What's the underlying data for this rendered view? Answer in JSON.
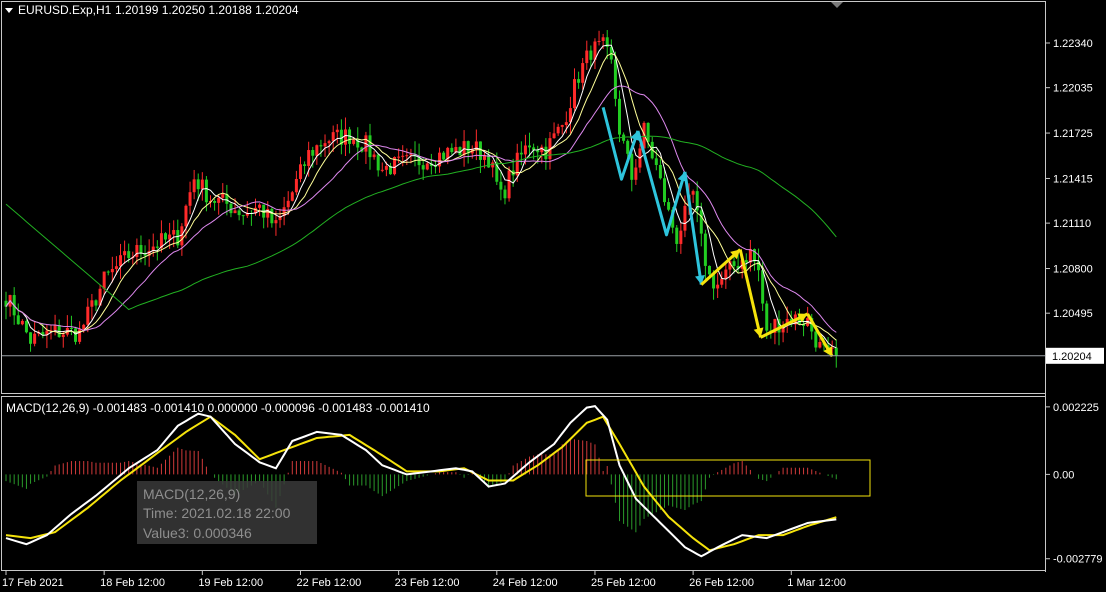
{
  "header": {
    "symbol": "EURUSD.Exp,H1",
    "ohlc": "1.20199 1.20250 1.20188 1.20204"
  },
  "macd_header": "MACD(12,26,9) -0.001483 -0.001410 0.000000 -0.000096 -0.001483 -0.001410",
  "tooltip": {
    "line1": "MACD(12,26,9)",
    "line2": "Time: 2021.02.18 22:00",
    "line3": "Value3: 0.000346"
  },
  "colors": {
    "background": "#000000",
    "bull": "#ff2a2a",
    "bear": "#22cc22",
    "ma_fast": "#ffffff",
    "ma_mid": "#ffff99",
    "ma_slow": "#dd88ee",
    "ma_long": "#22b022",
    "macd_main": "#ffffff",
    "macd_signal": "#f5e30b",
    "hist_pos": "#d13a3a",
    "hist_neg": "#2a9a2a",
    "arrow_cyan": "#2ec4dc",
    "arrow_yellow": "#f5e30b",
    "box": "#f5e30b",
    "price_line": "#9aa0a6"
  },
  "chart_data": [
    {
      "type": "candlestick",
      "title": "EURUSD.Exp,H1",
      "y_ticks": [
        1.20495,
        1.208,
        1.2111,
        1.21415,
        1.21725,
        1.22035,
        1.2234
      ],
      "y_tick_labels": [
        "1.20495",
        "1.20800",
        "1.21110",
        "1.21415",
        "1.21725",
        "1.22035",
        "1.22340"
      ],
      "ylim": [
        1.1995,
        1.2262
      ],
      "current_price": 1.20204,
      "current_price_label": "1.20204",
      "grid": false,
      "legend": "none",
      "x_tick_labels": [
        "17 Feb 2021",
        "18 Feb 12:00",
        "19 Feb 12:00",
        "22 Feb 12:00",
        "23 Feb 12:00",
        "24 Feb 12:00",
        "25 Feb 12:00",
        "26 Feb 12:00",
        "1 Mar 12:00"
      ],
      "x_tick_index": [
        0,
        24,
        48,
        72,
        96,
        120,
        144,
        168,
        192
      ],
      "close_keypoints": [
        [
          0,
          1.2061
        ],
        [
          6,
          1.2031
        ],
        [
          12,
          1.2037
        ],
        [
          18,
          1.2036
        ],
        [
          24,
          1.2072
        ],
        [
          30,
          1.2089
        ],
        [
          36,
          1.2096
        ],
        [
          42,
          1.2102
        ],
        [
          46,
          1.2142
        ],
        [
          50,
          1.2128
        ],
        [
          54,
          1.2124
        ],
        [
          58,
          1.2118
        ],
        [
          62,
          1.2122
        ],
        [
          66,
          1.2108
        ],
        [
          70,
          1.2132
        ],
        [
          74,
          1.2158
        ],
        [
          78,
          1.2168
        ],
        [
          84,
          1.2171
        ],
        [
          88,
          1.2164
        ],
        [
          92,
          1.2148
        ],
        [
          96,
          1.2151
        ],
        [
          100,
          1.2153
        ],
        [
          104,
          1.2156
        ],
        [
          108,
          1.2159
        ],
        [
          114,
          1.2163
        ],
        [
          118,
          1.2156
        ],
        [
          121,
          1.2128
        ],
        [
          124,
          1.2148
        ],
        [
          128,
          1.2166
        ],
        [
          132,
          1.2161
        ],
        [
          136,
          1.2178
        ],
        [
          140,
          1.2212
        ],
        [
          143,
          1.2229
        ],
        [
          146,
          1.2231
        ],
        [
          148,
          1.2219
        ],
        [
          150,
          1.2175
        ],
        [
          153,
          1.2142
        ],
        [
          156,
          1.2174
        ],
        [
          159,
          1.2149
        ],
        [
          162,
          1.2117
        ],
        [
          164,
          1.2101
        ],
        [
          168,
          1.2131
        ],
        [
          170,
          1.2098
        ],
        [
          172,
          1.2074
        ],
        [
          174,
          1.2069
        ],
        [
          178,
          1.2082
        ],
        [
          182,
          1.2091
        ],
        [
          184,
          1.2078
        ],
        [
          186,
          1.2034
        ],
        [
          188,
          1.2042
        ],
        [
          192,
          1.2046
        ],
        [
          196,
          1.2044
        ],
        [
          199,
          1.2026
        ],
        [
          201,
          1.202
        ],
        [
          203,
          1.20204
        ]
      ]
    },
    {
      "type": "line",
      "title": "MACD(12,26,9)",
      "y_ticks": [
        0.002225,
        0.0,
        -0.002779
      ],
      "y_tick_labels": [
        "0.002225",
        "0.00",
        "-0.002779"
      ],
      "ylim": [
        -0.00315,
        0.00255
      ],
      "macd_keypoints": [
        [
          0,
          -0.0021
        ],
        [
          5,
          -0.0023
        ],
        [
          10,
          -0.002
        ],
        [
          16,
          -0.0013
        ],
        [
          22,
          -0.0007
        ],
        [
          30,
          0.0002
        ],
        [
          37,
          0.0008
        ],
        [
          42,
          0.0016
        ],
        [
          47,
          0.002
        ],
        [
          50,
          0.0019
        ],
        [
          56,
          0.001
        ],
        [
          62,
          0.0004
        ],
        [
          66,
          0.0002
        ],
        [
          70,
          0.0011
        ],
        [
          76,
          0.0014
        ],
        [
          82,
          0.0013
        ],
        [
          88,
          0.0008
        ],
        [
          92,
          0.0003
        ],
        [
          98,
          0.0
        ],
        [
          104,
          0.0001
        ],
        [
          110,
          0.0002
        ],
        [
          114,
          0.0001
        ],
        [
          118,
          -0.0004
        ],
        [
          122,
          -0.0003
        ],
        [
          128,
          0.0004
        ],
        [
          134,
          0.001
        ],
        [
          138,
          0.0017
        ],
        [
          142,
          0.0022
        ],
        [
          144,
          0.00225
        ],
        [
          147,
          0.0018
        ],
        [
          150,
          0.0003
        ],
        [
          154,
          -0.0008
        ],
        [
          160,
          -0.0016
        ],
        [
          166,
          -0.0024
        ],
        [
          170,
          -0.0027
        ],
        [
          174,
          -0.0024
        ],
        [
          180,
          -0.002
        ],
        [
          186,
          -0.0021
        ],
        [
          190,
          -0.0019
        ],
        [
          196,
          -0.0016
        ],
        [
          203,
          -0.001483
        ]
      ],
      "signal_keypoints": [
        [
          0,
          -0.002
        ],
        [
          6,
          -0.0021
        ],
        [
          12,
          -0.0019
        ],
        [
          20,
          -0.0011
        ],
        [
          28,
          -0.0002
        ],
        [
          36,
          0.0006
        ],
        [
          44,
          0.0014
        ],
        [
          50,
          0.0019
        ],
        [
          56,
          0.0013
        ],
        [
          62,
          0.0005
        ],
        [
          68,
          0.0008
        ],
        [
          76,
          0.0012
        ],
        [
          84,
          0.0013
        ],
        [
          90,
          0.0008
        ],
        [
          98,
          0.0001
        ],
        [
          106,
          0.0001
        ],
        [
          112,
          0.0002
        ],
        [
          118,
          -0.0002
        ],
        [
          124,
          -0.0002
        ],
        [
          130,
          0.0003
        ],
        [
          136,
          0.0009
        ],
        [
          142,
          0.0017
        ],
        [
          146,
          0.0019
        ],
        [
          150,
          0.001
        ],
        [
          156,
          -0.0004
        ],
        [
          162,
          -0.0014
        ],
        [
          168,
          -0.0021
        ],
        [
          172,
          -0.0025
        ],
        [
          178,
          -0.0023
        ],
        [
          184,
          -0.002
        ],
        [
          190,
          -0.002
        ],
        [
          196,
          -0.0017
        ],
        [
          203,
          -0.00141
        ]
      ]
    }
  ]
}
